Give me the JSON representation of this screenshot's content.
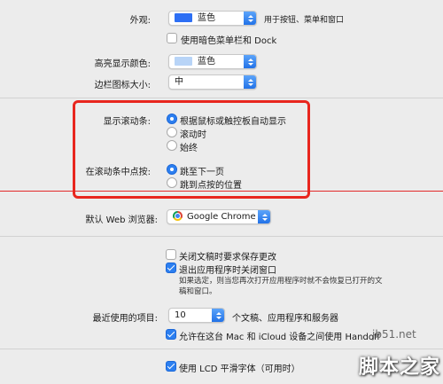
{
  "appearance": {
    "label": "外观:",
    "value": "蓝色",
    "swatch_color": "#2d6ff4",
    "note": "用于按钮、菜单和窗口",
    "dark_menu_label": "使用暗色菜单栏和 Dock"
  },
  "highlight": {
    "label": "高亮显示颜色:",
    "value": "蓝色",
    "swatch_color": "#b8d4f7"
  },
  "sidebar_icon": {
    "label": "边栏图标大小:",
    "value": "中"
  },
  "scrollbars": {
    "label": "显示滚动条:",
    "options": [
      "根据鼠标或触控板自动显示",
      "滚动时",
      "始终"
    ]
  },
  "click_scroll": {
    "label": "在滚动条中点按:",
    "options": [
      "跳至下一页",
      "跳到点按的位置"
    ]
  },
  "browser": {
    "label": "默认 Web 浏览器:",
    "value": "Google Chrome"
  },
  "documents": {
    "ask_keep": "关闭文稿时要求保存更改",
    "close_windows": "退出应用程序时关闭窗口",
    "help_text": "如果选定，则当您再次打开应用程序时就不会恢复已打开的文稿和窗口。"
  },
  "recent": {
    "label": "最近使用的项目:",
    "value": "10",
    "suffix": "个文稿、应用程序和服务器"
  },
  "handoff": {
    "label": "允许在这台 Mac 和 iCloud 设备之间使用 Handoff"
  },
  "lcd": {
    "label": "使用 LCD 平滑字体（可用时）"
  },
  "watermark": {
    "domain": "jb51.net",
    "site_name": "脚本之家"
  }
}
